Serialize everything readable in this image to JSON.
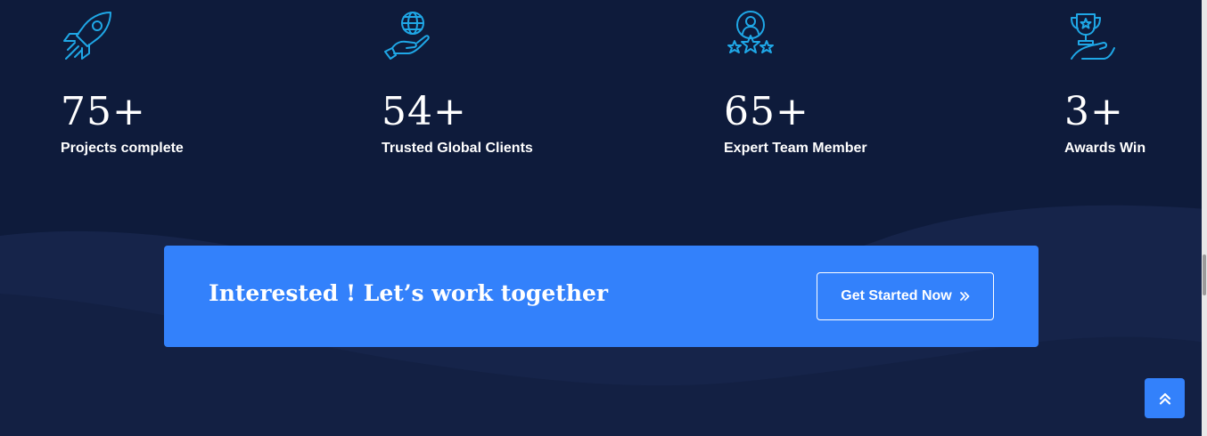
{
  "colors": {
    "background": "#0e1b3b",
    "wave": "#17264a",
    "accent": "#3381fb",
    "icon": "#1fa7e6",
    "text": "#ffffff"
  },
  "stats": [
    {
      "icon": "rocket-icon",
      "number": "75+",
      "label": "Projects complete"
    },
    {
      "icon": "globe-in-hand-icon",
      "number": "54+",
      "label": "Trusted Global Clients"
    },
    {
      "icon": "user-stars-icon",
      "number": "65+",
      "label": "Expert Team Member"
    },
    {
      "icon": "trophy-icon",
      "number": "3+",
      "label": "Awards Win"
    }
  ],
  "cta": {
    "text": "Interested ! Let’s work together",
    "button_label": "Get Started Now",
    "button_icon": "double-chevron-right-icon"
  },
  "scroll_top": {
    "icon": "double-chevron-up-icon"
  }
}
